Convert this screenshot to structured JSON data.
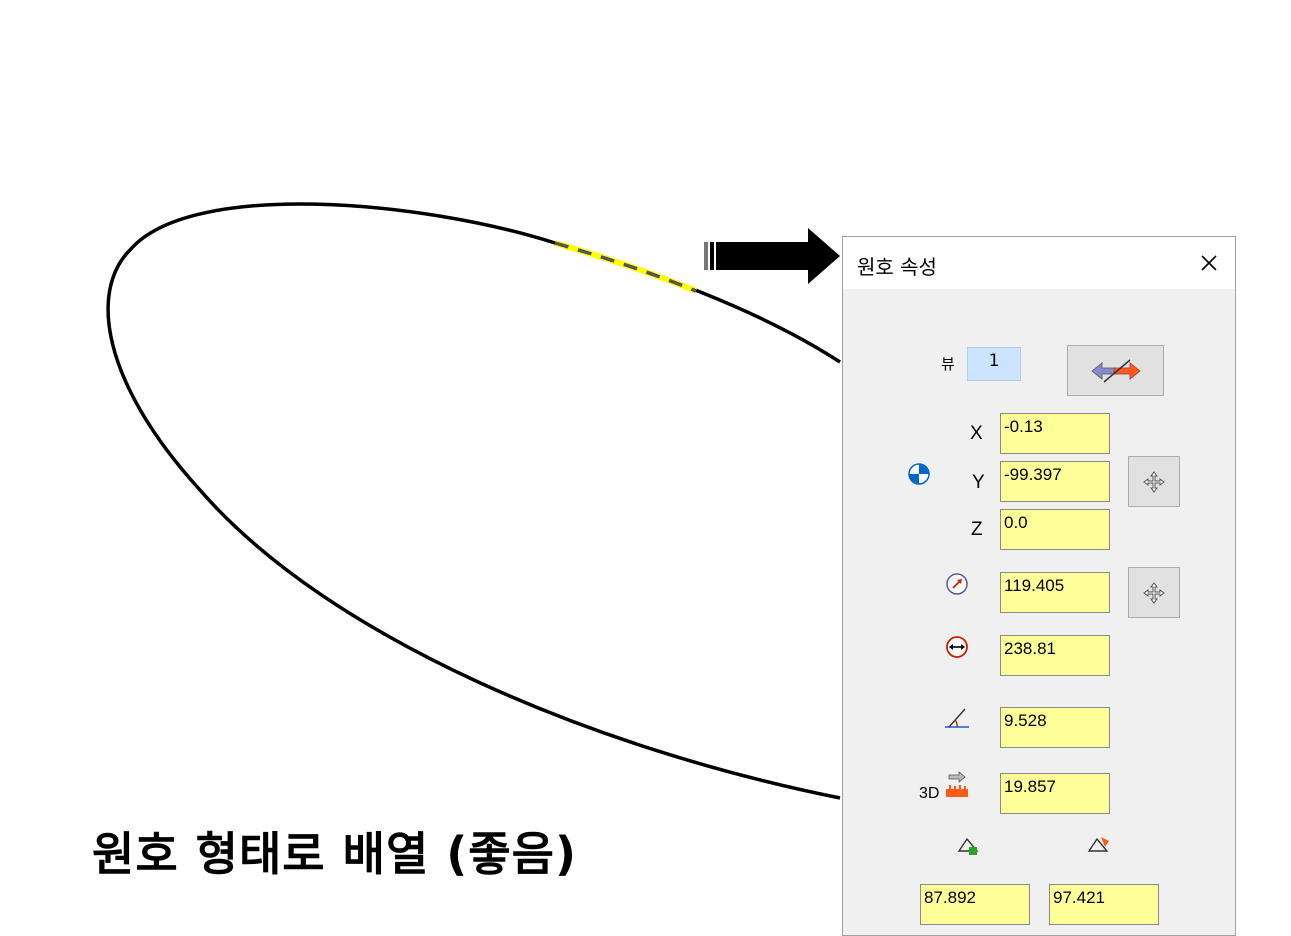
{
  "caption": "원호 형태로 배열 (좋음)",
  "dialog": {
    "title": "원호 속성",
    "view_label": "뷰",
    "view_value": "1",
    "x_label": "X",
    "y_label": "Y",
    "z_label": "Z",
    "x_value": "-0.13",
    "y_value": "-99.397",
    "z_value": "0.0",
    "radius_value": "119.405",
    "diameter_value": "238.81",
    "angle_value": "9.528",
    "length_3d_label": "3D",
    "length_3d_value": "19.857",
    "start_angle_value": "87.892",
    "end_angle_value": "97.421"
  },
  "colors": {
    "field_bg": "#ffff99",
    "highlight_arc": "#ffff00",
    "view_bg": "#cce4ff"
  }
}
